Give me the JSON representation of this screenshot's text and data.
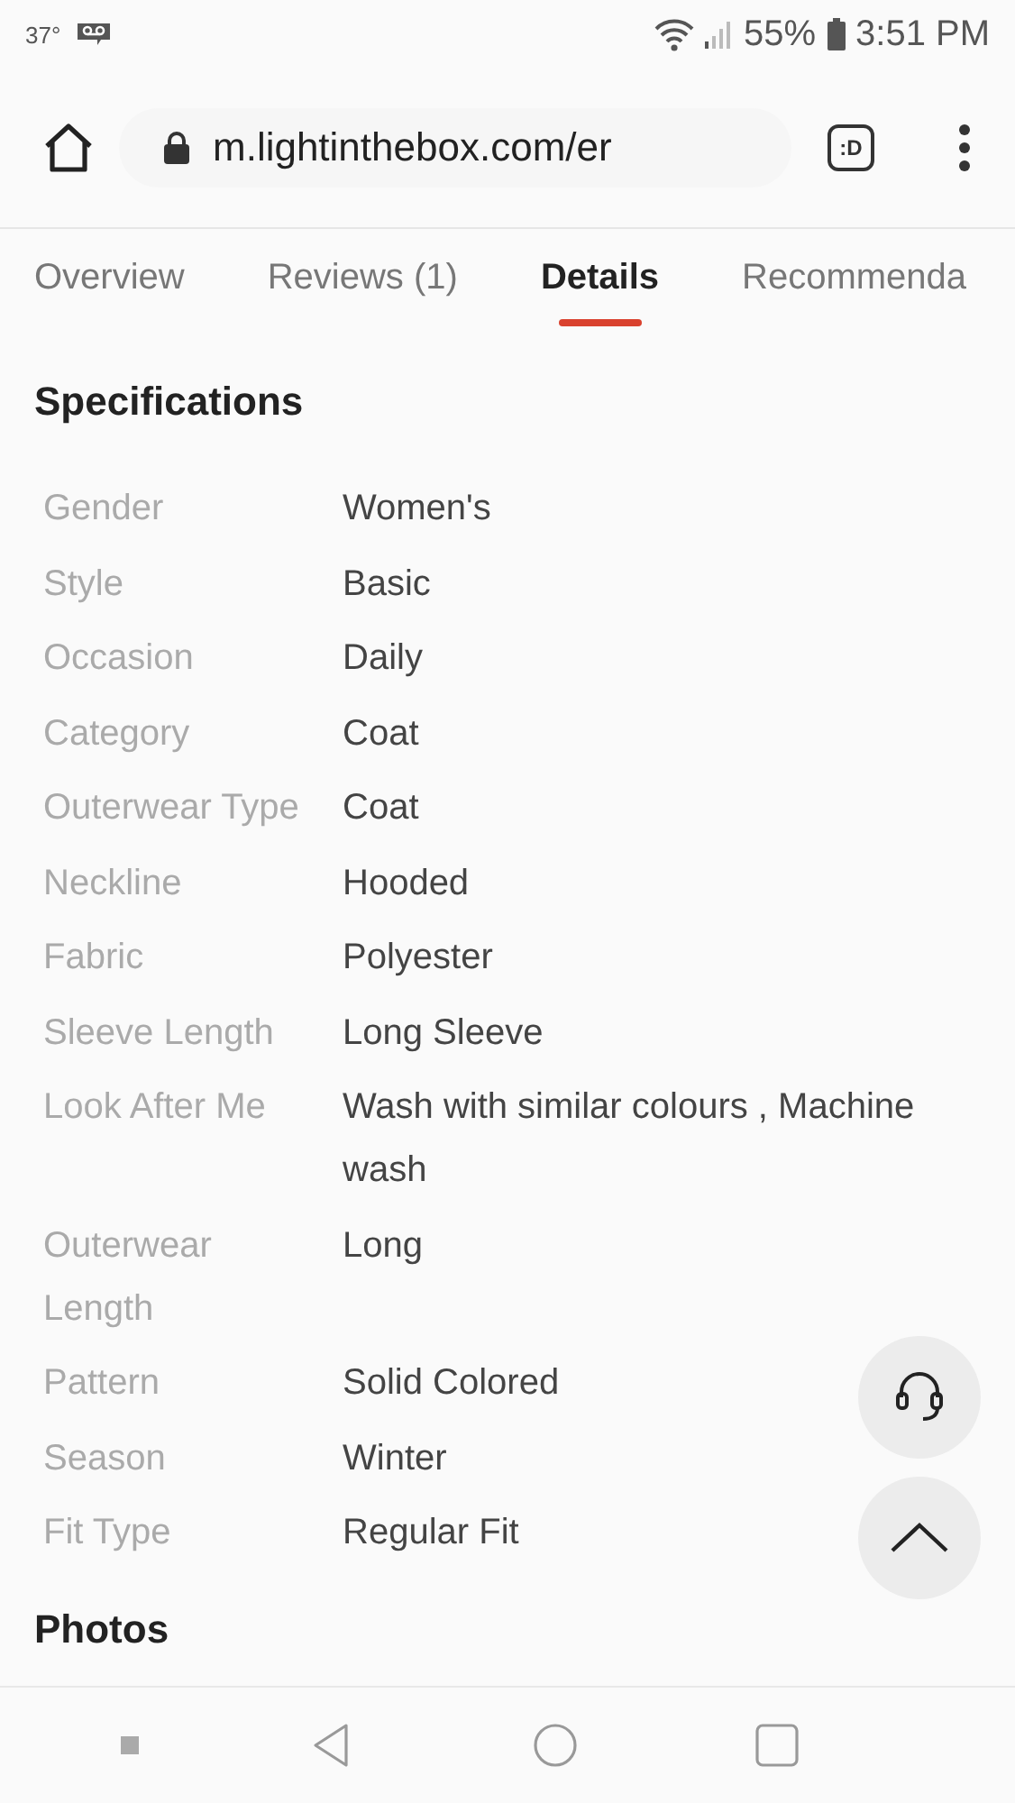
{
  "status_bar": {
    "temperature": "37°",
    "battery": "55%",
    "time": "3:51 PM"
  },
  "browser": {
    "url": "m.lightinthebox.com/er",
    "tab_badge": ":D"
  },
  "tabs": [
    {
      "label": "Overview",
      "selected": false
    },
    {
      "label": "Reviews (1)",
      "selected": false
    },
    {
      "label": "Details",
      "selected": true
    },
    {
      "label": "Recommenda",
      "selected": false
    }
  ],
  "specifications": {
    "title": "Specifications",
    "rows": [
      {
        "label": "Gender",
        "value": "Women's"
      },
      {
        "label": "Style",
        "value": "Basic"
      },
      {
        "label": "Occasion",
        "value": "Daily"
      },
      {
        "label": "Category",
        "value": "Coat"
      },
      {
        "label": "Outerwear Type",
        "value": "Coat"
      },
      {
        "label": "Neckline",
        "value": "Hooded"
      },
      {
        "label": "Fabric",
        "value": "Polyester"
      },
      {
        "label": "Sleeve Length",
        "value": "Long Sleeve"
      },
      {
        "label": "Look After Me",
        "value": "Wash with similar colours , Machine wash"
      },
      {
        "label": "Outerwear Length",
        "value": "Long"
      },
      {
        "label": "Pattern",
        "value": "Solid Colored"
      },
      {
        "label": "Season",
        "value": "Winter"
      },
      {
        "label": "Fit Type",
        "value": "Regular Fit"
      }
    ]
  },
  "photos": {
    "title": "Photos"
  }
}
